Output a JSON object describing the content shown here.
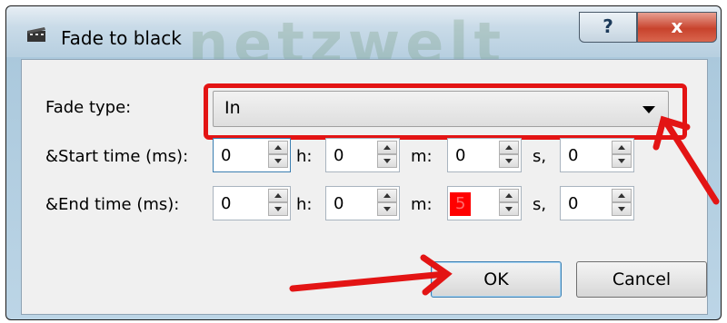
{
  "window": {
    "title": "Fade to black",
    "watermark": "netzwelt",
    "help_glyph": "?",
    "close_glyph": "x"
  },
  "fade_type": {
    "label": "Fade type:",
    "value": "In"
  },
  "start_time": {
    "label": "&Start time (ms):",
    "ms": "0",
    "h_label": "h:",
    "h": "0",
    "m_label": "m:",
    "m": "0",
    "s_label": "s,",
    "s": "0"
  },
  "end_time": {
    "label": "&End time (ms):",
    "ms": "0",
    "h_label": "h:",
    "h": "0",
    "m_label": "m:",
    "m": "5",
    "s_label": "s,",
    "s": "0"
  },
  "buttons": {
    "ok": "OK",
    "cancel": "Cancel"
  },
  "colors": {
    "annotation": "#e31414",
    "highlight": "#ff0000"
  },
  "icons": [
    "app-icon",
    "help-icon",
    "close-icon",
    "dropdown-arrow-icon",
    "spin-up-icon",
    "spin-down-icon"
  ]
}
